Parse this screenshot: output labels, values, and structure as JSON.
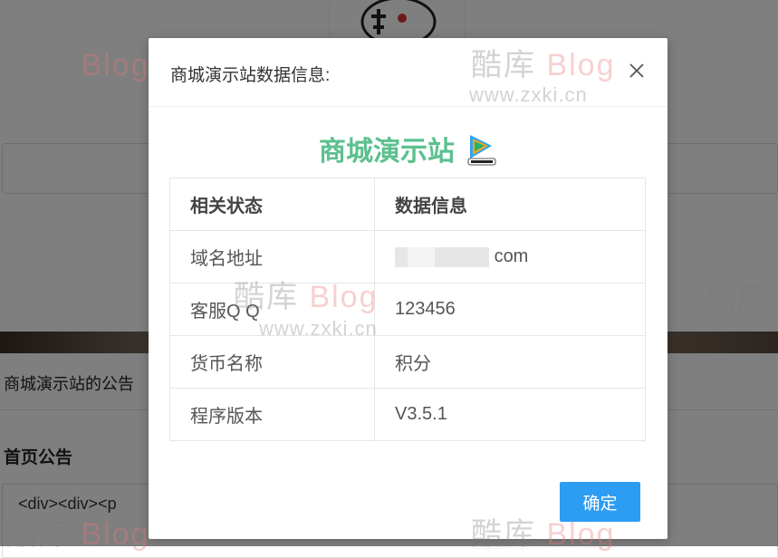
{
  "background": {
    "notice_text": "商城演示站的公告",
    "home_notice_title": "首页公告",
    "code_snippet": "<div><div><p"
  },
  "watermark": {
    "brand": "酷库",
    "blog": "Blog",
    "url": "www.zxki.cn"
  },
  "dialog": {
    "title": "商城演示站数据信息:",
    "brand_name": "商城演示站",
    "brand_logo_icon": "tencent-video-logo",
    "table": {
      "headers": [
        "相关状态",
        "数据信息"
      ],
      "rows": [
        {
          "label": "域名地址",
          "value": "com"
        },
        {
          "label": "客服Q Q",
          "value": "123456"
        },
        {
          "label": "货币名称",
          "value": "积分"
        },
        {
          "label": "程序版本",
          "value": "V3.5.1"
        }
      ]
    },
    "confirm_label": "确定"
  },
  "colors": {
    "brand_green": "#5cc08f",
    "button_blue": "#2d9cf3"
  }
}
